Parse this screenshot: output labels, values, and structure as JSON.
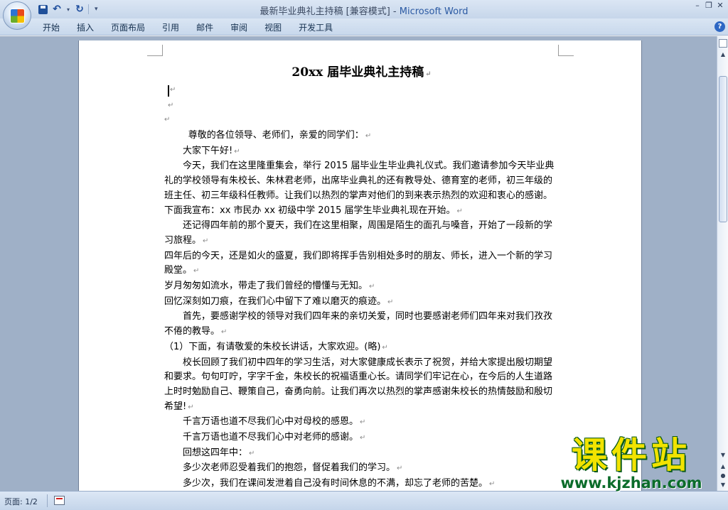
{
  "window": {
    "title": "最新毕业典礼主持稿 [兼容模式]",
    "separator": " - ",
    "app_name": "Microsoft Word"
  },
  "quick_access": {
    "icons": [
      "save-icon",
      "undo-icon",
      "redo-icon",
      "customize-icon"
    ],
    "undo_glyph": "↶",
    "redo_glyph": "↻",
    "dropdown_glyph": "▾",
    "customize_glyph": "▾"
  },
  "window_controls": {
    "minimize": "–",
    "restore": "❐",
    "close": "✕"
  },
  "ribbon": {
    "tabs": [
      {
        "label": "开始"
      },
      {
        "label": "插入"
      },
      {
        "label": "页面布局"
      },
      {
        "label": "引用"
      },
      {
        "label": "邮件"
      },
      {
        "label": "审阅"
      },
      {
        "label": "视图"
      },
      {
        "label": "开发工具"
      }
    ],
    "help_glyph": "?"
  },
  "document": {
    "title": "20xx 届毕业典礼主持稿",
    "paragraph_mark": "↵",
    "paragraphs": [
      "尊敬的各位领导、老师们，亲爱的同学们：",
      "大家下午好!",
      "今天，我们在这里隆重集会，举行 2015 届毕业生毕业典礼仪式。我们邀请参加今天毕业典礼的学校领导有朱校长、朱林君老师，出席毕业典礼的还有教导处、德育室的老师，初三年级的班主任、初三年级科任教师。让我们以热烈的掌声对他们的到来表示热烈的欢迎和衷心的感谢。下面我宣布：xx 市民办 xx 初级中学 2015 届学生毕业典礼现在开始。",
      "还记得四年前的那个夏天，我们在这里相聚，周围是陌生的面孔与嗓音，开始了一段新的学习旅程。",
      "四年后的今天，还是如火的盛夏，我们即将挥手告别相处多时的朋友、师长，进入一个新的学习殿堂。",
      "岁月匆匆如流水，带走了我们曾经的懵懂与无知。",
      "回忆深刻如刀痕，在我们心中留下了难以磨灭的痕迹。",
      "首先，要感谢学校的领导对我们四年来的亲切关爱，同时也要感谢老师们四年来对我们孜孜不倦的教导。",
      "（1）下面，有请敬爱的朱校长讲话，大家欢迎。(略)",
      "校长回顾了我们初中四年的学习生活，对大家健康成长表示了祝贺，并给大家提出殷切期望和要求。句句叮咛，字字千金，朱校长的祝福语重心长。请同学们牢记在心，在今后的人生道路上时时勉励自己、鞭策自己，奋勇向前。让我们再次以热烈的掌声感谢朱校长的热情鼓励和殷切希望!",
      "千言万语也道不尽我们心中对母校的感恩。",
      "千言万语也道不尽我们心中对老师的感谢。",
      "回想这四年中：",
      "多少次老师忍受着我们的抱怨，督促着我们的学习。",
      "多少次，我们在课间发泄着自己没有时间休息的不满，却忘了老师的苦楚。"
    ]
  },
  "scrollbar": {
    "up_glyph": "▲",
    "down_glyph": "▼",
    "prev_page_glyph": "▲",
    "browse_glyph": "●",
    "next_page_glyph": "▼"
  },
  "status_bar": {
    "page_count": "页面: 1/2"
  },
  "watermark": {
    "title": "课件站",
    "url": "www.kjzhan.com"
  }
}
